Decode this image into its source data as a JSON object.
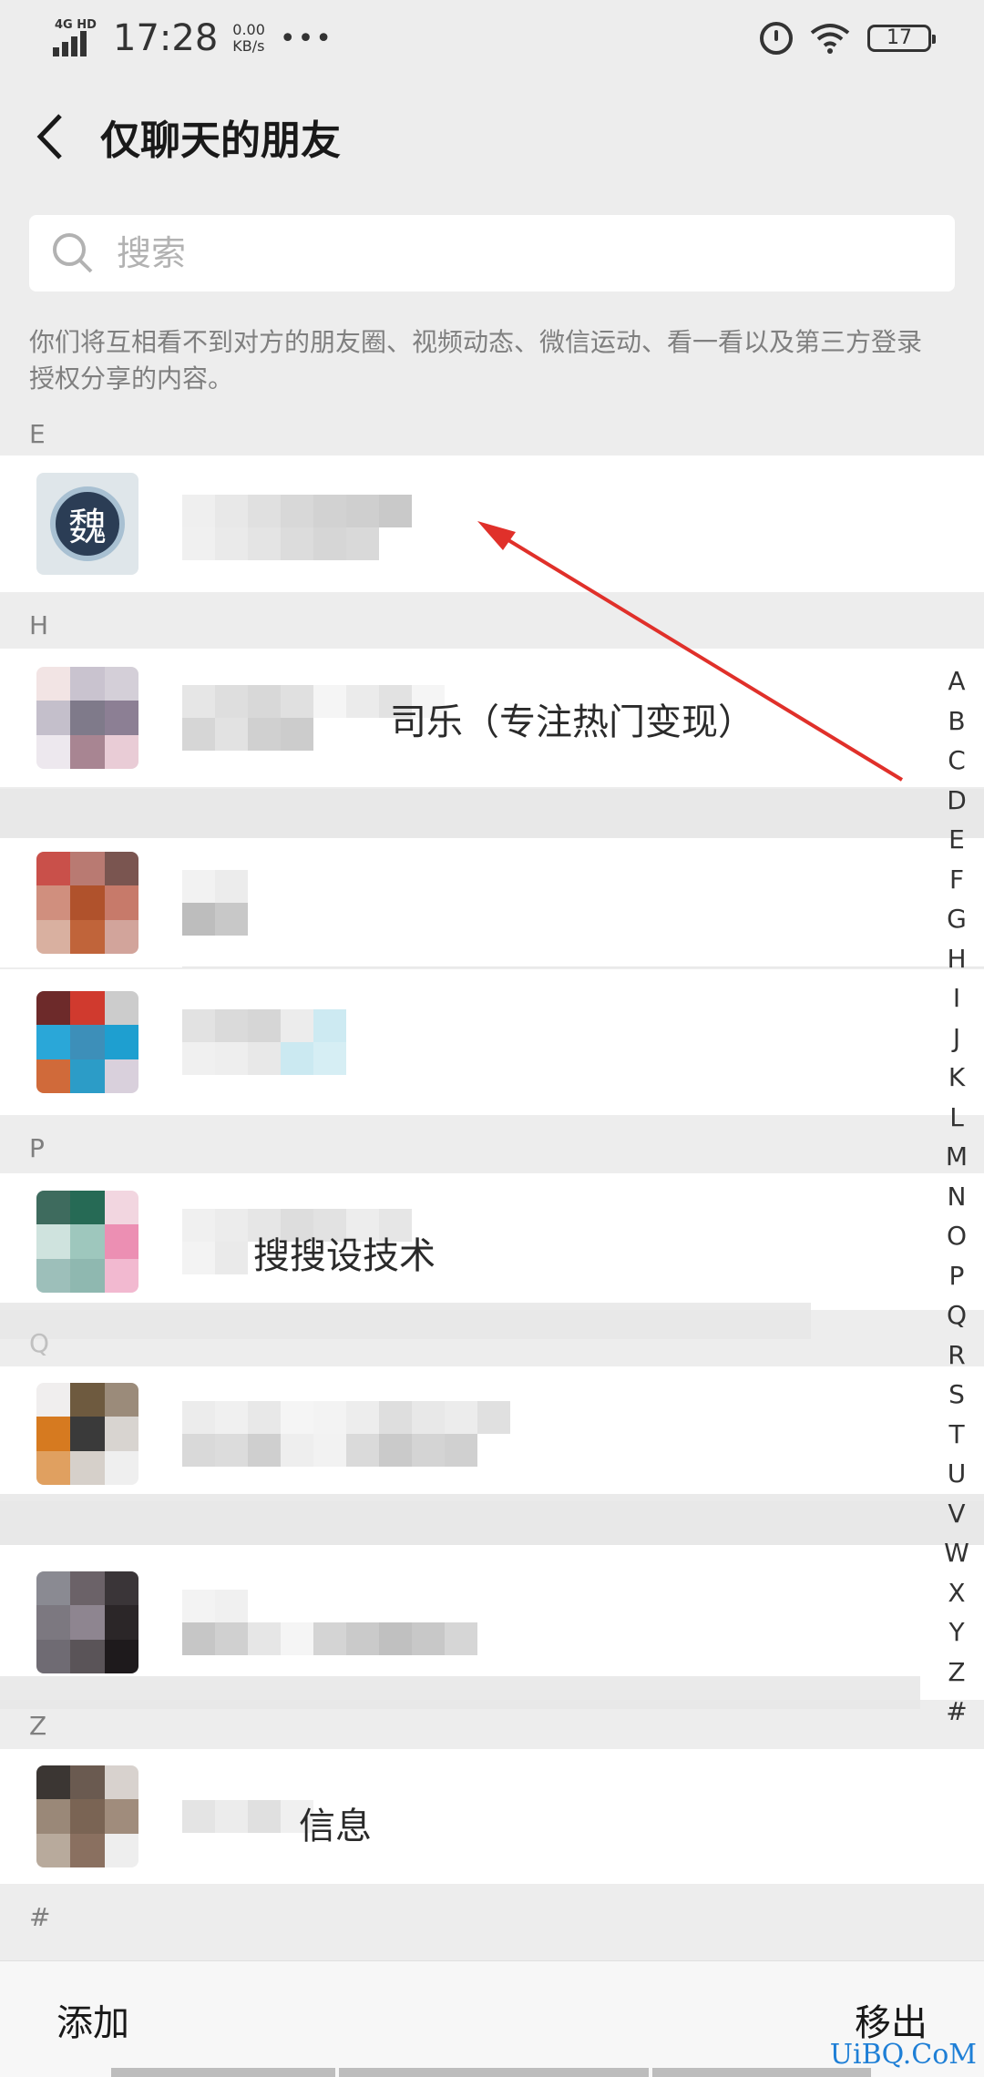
{
  "status_bar": {
    "network": "4G HD",
    "time": "17:28",
    "speed_value": "0.00",
    "speed_unit": "KB/s",
    "more": "•••",
    "battery": "17"
  },
  "header": {
    "title": "仅聊天的朋友"
  },
  "search": {
    "placeholder": "搜索"
  },
  "notice": "你们将互相看不到对方的朋友圈、视频动态、微信运动、看一看以及第三方登录授权分享的内容。",
  "sections": [
    {
      "letter": "E"
    },
    {
      "letter": "H"
    },
    {
      "letter": "P"
    },
    {
      "letter": "Q"
    },
    {
      "letter": "Z"
    },
    {
      "letter": "#"
    }
  ],
  "contacts": [
    {
      "section": "E",
      "avatar": "wei-logo",
      "avatar_text": "魏",
      "name_visible": ""
    },
    {
      "section": "H",
      "avatar": "pixelated",
      "name_visible": "司乐（专注热门变现）"
    },
    {
      "section": "H",
      "avatar": "pixelated",
      "name_visible": ""
    },
    {
      "section": "H",
      "avatar": "pixelated",
      "name_visible": ""
    },
    {
      "section": "P",
      "avatar": "pixelated",
      "name_visible": "搜搜设技术"
    },
    {
      "section": "Q",
      "avatar": "pixelated",
      "name_visible": ""
    },
    {
      "section": "",
      "avatar": "pixelated",
      "name_visible": ""
    },
    {
      "section": "Z",
      "avatar": "pixelated",
      "name_visible": "信息"
    }
  ],
  "index_letters": [
    "A",
    "B",
    "C",
    "D",
    "E",
    "F",
    "G",
    "H",
    "I",
    "J",
    "K",
    "L",
    "M",
    "N",
    "O",
    "P",
    "Q",
    "R",
    "S",
    "T",
    "U",
    "V",
    "W",
    "X",
    "Y",
    "Z",
    "#"
  ],
  "bottom": {
    "add_label": "添加",
    "remove_label": "移出"
  },
  "watermark": "UiBQ.CoM",
  "colors": {
    "annotation_arrow": "#e0302a",
    "background": "#ededed",
    "hint_text": "#7f7f7f"
  }
}
